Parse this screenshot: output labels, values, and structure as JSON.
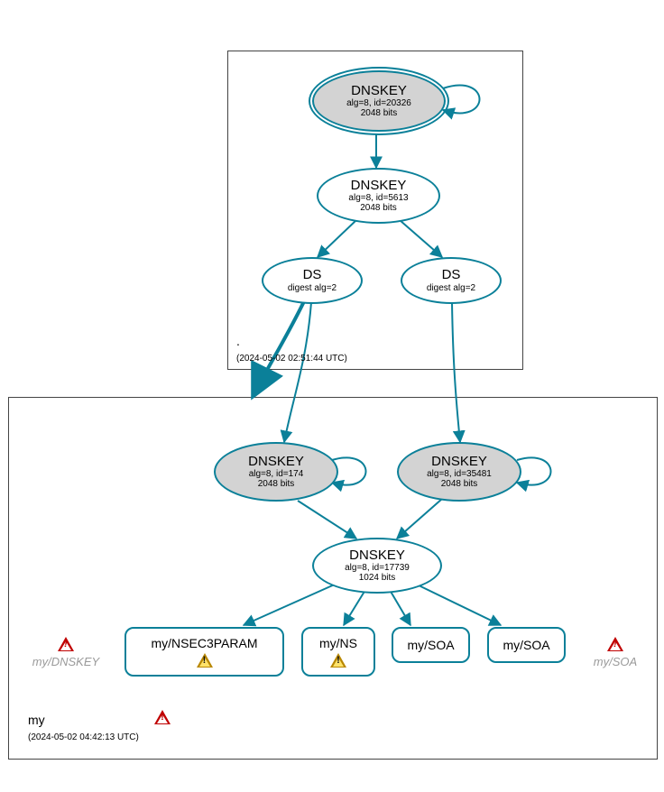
{
  "zones": {
    "root": {
      "label": ".",
      "timestamp": "(2024-05-02 02:51:44 UTC)"
    },
    "my": {
      "label": "my",
      "timestamp": "(2024-05-02 04:42:13 UTC)"
    }
  },
  "nodes": {
    "root_ksk": {
      "title": "DNSKEY",
      "line2": "alg=8, id=20326",
      "line3": "2048 bits"
    },
    "root_zsk": {
      "title": "DNSKEY",
      "line2": "alg=8, id=5613",
      "line3": "2048 bits"
    },
    "ds1": {
      "title": "DS",
      "line2": "digest alg=2"
    },
    "ds2": {
      "title": "DS",
      "line2": "digest alg=2"
    },
    "my_ksk1": {
      "title": "DNSKEY",
      "line2": "alg=8, id=174",
      "line3": "2048 bits"
    },
    "my_ksk2": {
      "title": "DNSKEY",
      "line2": "alg=8, id=35481",
      "line3": "2048 bits"
    },
    "my_zsk": {
      "title": "DNSKEY",
      "line2": "alg=8, id=17739",
      "line3": "1024 bits"
    }
  },
  "records": {
    "nsec3": "my/NSEC3PARAM",
    "ns": "my/NS",
    "soa1": "my/SOA",
    "soa2": "my/SOA"
  },
  "ghosts": {
    "left": "my/DNSKEY",
    "right": "my/SOA"
  }
}
